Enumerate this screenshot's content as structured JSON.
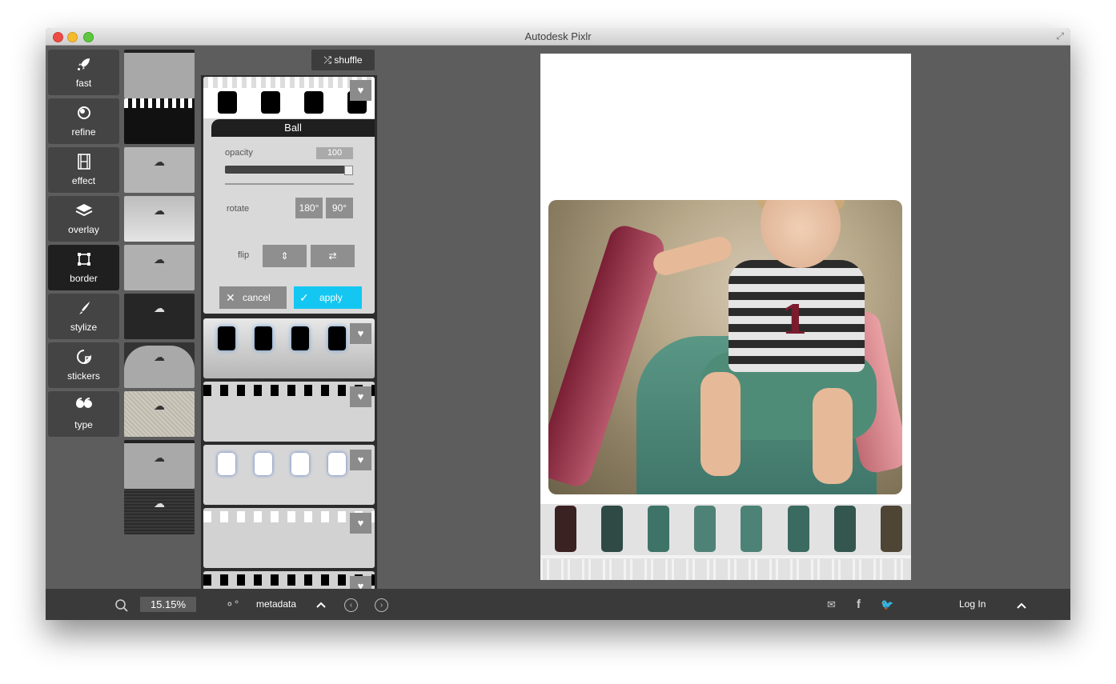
{
  "window": {
    "title": "Autodesk Pixlr"
  },
  "toolbar": {
    "items": [
      {
        "label": "fast",
        "icon": "rocket-icon",
        "glyph": "🚀"
      },
      {
        "label": "refine",
        "icon": "refine-icon",
        "glyph": "◎"
      },
      {
        "label": "effect",
        "icon": "film-icon",
        "glyph": "🎞"
      },
      {
        "label": "overlay",
        "icon": "layers-icon",
        "glyph": "◈"
      },
      {
        "label": "border",
        "icon": "border-frame-icon",
        "glyph": "⬚",
        "active": true
      },
      {
        "label": "stylize",
        "icon": "brush-icon",
        "glyph": "✎"
      },
      {
        "label": "stickers",
        "icon": "sticker-icon",
        "glyph": "◔"
      },
      {
        "label": "type",
        "icon": "quote-icon",
        "glyph": "❝"
      }
    ]
  },
  "panel": {
    "shuffle_label": "shuffle",
    "editor": {
      "name": "Ball",
      "opacity_label": "opacity",
      "opacity_value": "100",
      "opacity_fraction": 1.0,
      "rotate_label": "rotate",
      "rotate_180": "180°",
      "rotate_90": "90°",
      "flip_label": "flip",
      "cancel_label": "cancel",
      "apply_label": "apply"
    }
  },
  "statusbar": {
    "zoom": "15.15%",
    "metadata_label": "metadata",
    "login_label": "Log In"
  },
  "colors": {
    "accent": "#13c7f2",
    "panel_bg": "#5d5d5d",
    "statusbar_bg": "#3a3a3a"
  }
}
